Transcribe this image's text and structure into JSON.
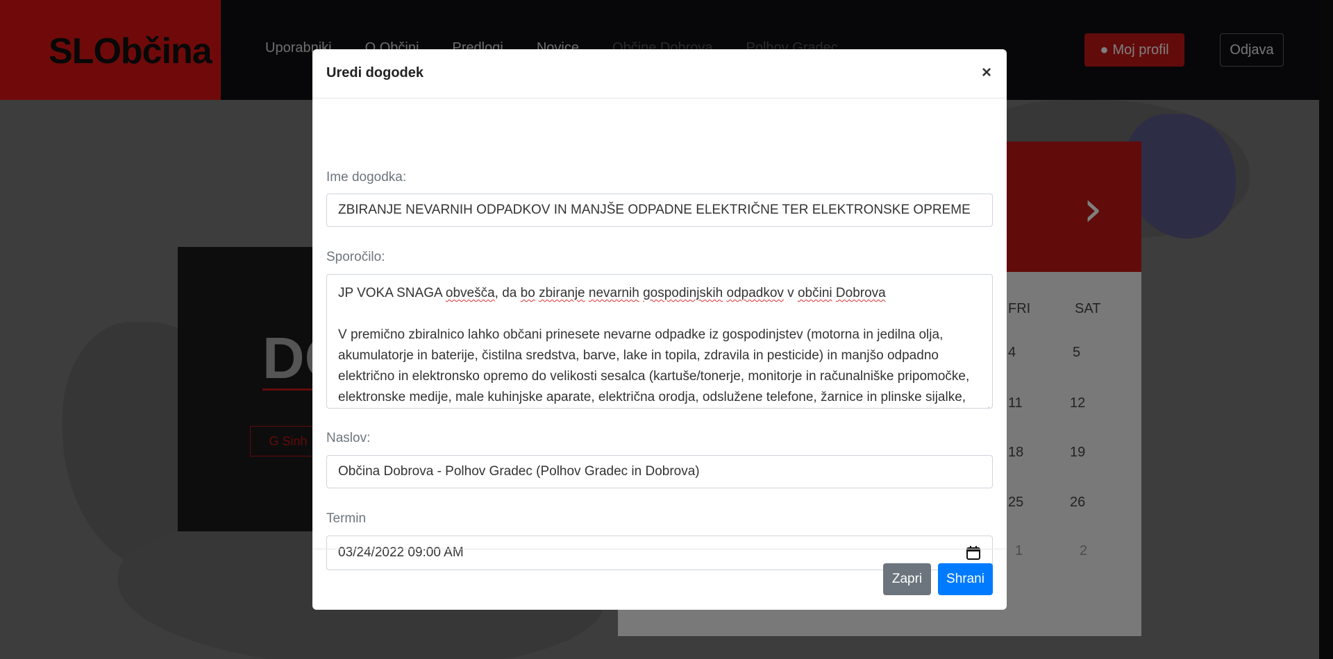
{
  "background": {
    "brand": "SLObčina",
    "nav_items": [
      "Uporabniki",
      "O Občini",
      "Predlogi",
      "Novice",
      "Občine Dobrova",
      "Polhov Gradec"
    ],
    "profile_button": "Moj profil",
    "logout_button": "Odjava",
    "hero_title": "DO",
    "hero_button": "G Sinh",
    "calendar_headers": [
      "FRI",
      "SAT"
    ],
    "calendar_days": [
      "4",
      "5",
      "11",
      "12",
      "18",
      "19",
      "25",
      "26",
      "1",
      "2"
    ],
    "colors": {
      "brand_red": "#e01515",
      "navbar": "#0f0f12"
    }
  },
  "modal": {
    "title": "Uredi dogodek",
    "close_symbol": "×",
    "fields": {
      "event_name_label": "Ime dogodka:",
      "event_name_value": "ZBIRANJE NEVARNIH ODPADKOV IN MANJŠE ODPADNE ELEKTRIČNE TER ELEKTRONSKE OPREME",
      "message_label": "Sporočilo:",
      "message_line1": [
        "JP VOKA SNAGA ",
        "obvešča",
        ", da ",
        "bo",
        " ",
        "zbiranje",
        " ",
        "nevarnih",
        " ",
        "gospodinjskih",
        " ",
        "odpadkov",
        " v ",
        "občini",
        " ",
        "Dobrova"
      ],
      "message_paragraph2": "V premično zbiralnico lahko občani prinesete nevarne odpadke iz gospodinjstev (motorna in jedilna olja, akumulatorje in baterije, čistilna sredstva, barve, lake in topila, zdravila in pesticide) in manjšo odpadno električno in elektronsko opremo do velikosti sesalca (kartuše/tonerje, monitorje in računalniške pripomočke, elektronske medije, male kuhinjske aparate, električna orodja, odslužene telefone, žarnice in plinske sijalke, električne igrače). Občanom bo pri oddajanju odpadkov v pomoč strokovno",
      "address_label": "Naslov:",
      "address_value": "Občina Dobrova - Polhov Gradec (Polhov Gradec in Dobrova)",
      "date_label": "Termin",
      "date_value": "03/24/2022 09:00 AM"
    },
    "buttons": {
      "close_label": "Zapri",
      "save_label": "Shrani"
    },
    "colors": {
      "primary": "#007bff",
      "secondary": "#6c757d"
    }
  }
}
